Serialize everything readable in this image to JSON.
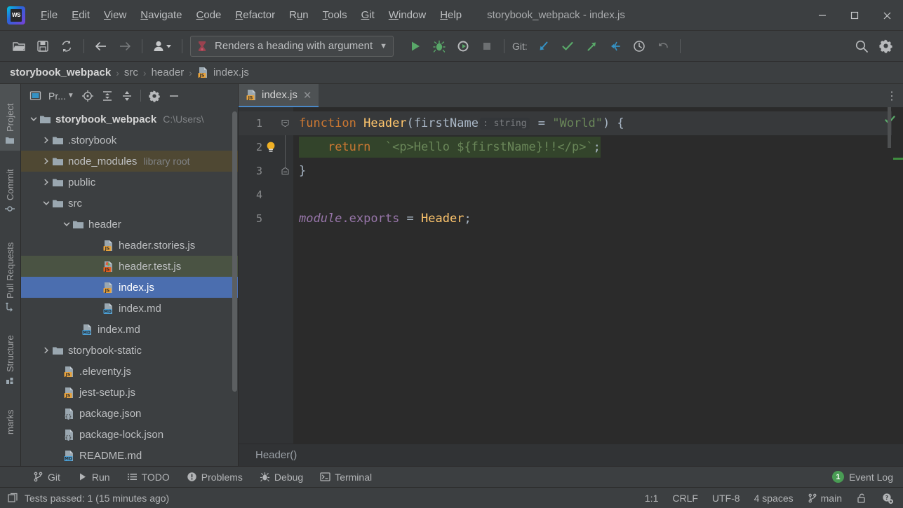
{
  "window": {
    "title": "storybook_webpack - index.js",
    "logo_text": "WS",
    "minimize_label": "—",
    "maximize_label": "□",
    "close_label": "✕"
  },
  "menubar": {
    "items": [
      {
        "label": "File",
        "mnemonic": "F"
      },
      {
        "label": "Edit",
        "mnemonic": "E"
      },
      {
        "label": "View",
        "mnemonic": "V"
      },
      {
        "label": "Navigate",
        "mnemonic": "N"
      },
      {
        "label": "Code",
        "mnemonic": "C"
      },
      {
        "label": "Refactor",
        "mnemonic": "R"
      },
      {
        "label": "Run",
        "mnemonic": "u"
      },
      {
        "label": "Tools",
        "mnemonic": "T"
      },
      {
        "label": "Git",
        "mnemonic": "G"
      },
      {
        "label": "Window",
        "mnemonic": "W"
      },
      {
        "label": "Help",
        "mnemonic": "H"
      }
    ]
  },
  "toolbar": {
    "open_tooltip": "Open",
    "save_tooltip": "Save All",
    "sync_tooltip": "Synchronize",
    "back_tooltip": "Back",
    "forward_tooltip": "Forward",
    "profile_tooltip": "User",
    "run_config": "Renders a heading with argument",
    "run_config_dropdown": "▼",
    "run_tooltip": "Run",
    "debug_tooltip": "Debug",
    "coverage_tooltip": "Run with Coverage",
    "stop_tooltip": "Stop",
    "git_label": "Git:",
    "git_update_tooltip": "Update Project",
    "git_commit_tooltip": "Commit",
    "git_push_tooltip": "Push",
    "git_rebase_tooltip": "Rebase",
    "git_history_tooltip": "History",
    "git_rollback_tooltip": "Rollback",
    "search_tooltip": "Search Everywhere",
    "settings_tooltip": "Settings"
  },
  "breadcrumb": {
    "items": [
      "storybook_webpack",
      "src",
      "header",
      "index.js"
    ],
    "separator": "›",
    "file_icon": "js-file-icon"
  },
  "stripe": {
    "items": [
      {
        "label": "Project",
        "icon": "folder-icon",
        "active": true
      },
      {
        "label": "Commit",
        "icon": "commit-icon",
        "active": false
      },
      {
        "label": "Pull Requests",
        "icon": "pull-request-icon",
        "active": false
      },
      {
        "label": "Structure",
        "icon": "structure-icon",
        "active": false
      },
      {
        "label": "marks",
        "icon": "bookmarks-icon",
        "active": false
      }
    ]
  },
  "project_panel": {
    "title": "Pr...",
    "dropdown_caret": "▼",
    "locate_tooltip": "Select Opened File",
    "expand_tooltip": "Expand All",
    "collapse_tooltip": "Collapse All",
    "settings_tooltip": "Options",
    "hide_tooltip": "Hide",
    "tree": [
      {
        "label": "storybook_webpack",
        "sub": "C:\\Users\\",
        "indent": 0,
        "arrow": "down",
        "icon": "folder-icon",
        "bold": true,
        "state": "none"
      },
      {
        "label": ".storybook",
        "sub": "",
        "indent": 1,
        "arrow": "right",
        "icon": "folder-icon",
        "bold": false,
        "state": "none"
      },
      {
        "label": "node_modules",
        "sub": "library root",
        "indent": 1,
        "arrow": "right",
        "icon": "folder-icon",
        "bold": false,
        "state": "libroot"
      },
      {
        "label": "public",
        "sub": "",
        "indent": 1,
        "arrow": "right",
        "icon": "folder-icon",
        "bold": false,
        "state": "none"
      },
      {
        "label": "src",
        "sub": "",
        "indent": 1,
        "arrow": "down",
        "icon": "folder-icon",
        "bold": false,
        "state": "none"
      },
      {
        "label": "header",
        "sub": "",
        "indent": 2,
        "arrow": "down",
        "icon": "folder-icon",
        "bold": false,
        "state": "none"
      },
      {
        "label": "header.stories.js",
        "sub": "",
        "indent": 3,
        "arrow": "none",
        "icon": "js-file-icon",
        "bold": false,
        "state": "none"
      },
      {
        "label": "header.test.js",
        "sub": "",
        "indent": 3,
        "arrow": "none",
        "icon": "js-test-file-icon",
        "bold": false,
        "state": "greenhl"
      },
      {
        "label": "index.js",
        "sub": "",
        "indent": 3,
        "arrow": "none",
        "icon": "js-file-icon",
        "bold": false,
        "state": "selected"
      },
      {
        "label": "index.md",
        "sub": "",
        "indent": 3,
        "arrow": "none",
        "icon": "md-file-icon",
        "bold": false,
        "state": "none"
      },
      {
        "label": "index.md",
        "sub": "",
        "indent": 2,
        "arrow": "none",
        "icon": "md-file-icon",
        "bold": false,
        "state": "none"
      },
      {
        "label": "storybook-static",
        "sub": "",
        "indent": 1,
        "arrow": "right",
        "icon": "folder-icon",
        "bold": false,
        "state": "none"
      },
      {
        "label": ".eleventy.js",
        "sub": "",
        "indent": 1,
        "arrow": "none",
        "icon": "js-file-icon",
        "bold": false,
        "state": "none"
      },
      {
        "label": "jest-setup.js",
        "sub": "",
        "indent": 1,
        "arrow": "none",
        "icon": "js-file-icon",
        "bold": false,
        "state": "none"
      },
      {
        "label": "package.json",
        "sub": "",
        "indent": 1,
        "arrow": "none",
        "icon": "json-file-icon",
        "bold": false,
        "state": "none"
      },
      {
        "label": "package-lock.json",
        "sub": "",
        "indent": 1,
        "arrow": "none",
        "icon": "json-file-icon",
        "bold": false,
        "state": "none"
      },
      {
        "label": "README.md",
        "sub": "",
        "indent": 1,
        "arrow": "none",
        "icon": "md-file-icon",
        "bold": false,
        "state": "none"
      }
    ]
  },
  "editor": {
    "tab": {
      "label": "index.js",
      "icon": "js-file-icon",
      "close": "✕"
    },
    "more_menu": "⋮",
    "lines": [
      {
        "number": "1",
        "fold": "open",
        "current": true,
        "bulb": false
      },
      {
        "number": "2",
        "fold": "none",
        "current": false,
        "bulb": true
      },
      {
        "number": "3",
        "fold": "close",
        "current": false,
        "bulb": false
      },
      {
        "number": "4",
        "fold": "none",
        "current": false,
        "bulb": false
      },
      {
        "number": "5",
        "fold": "none",
        "current": false,
        "bulb": false
      }
    ],
    "code": {
      "l1_kw": "function",
      "l1_fn": "Header",
      "l1_paren_open": "(",
      "l1_param": "firstName",
      "l1_inlay": ": string",
      "l1_eq": " = ",
      "l1_default": "\"World\"",
      "l1_tail": ") {",
      "l2_kw": "return",
      "l2_tpl": "`<p>Hello ${firstName}!!</p>`",
      "l2_semi": ";",
      "l3": "}",
      "l5_mod": "module",
      "l5_prop": ".exports",
      "l5_eq": " = ",
      "l5_ref": "Header",
      "l5_semi": ";"
    },
    "bottom_breadcrumb": "Header()",
    "inspection_status": "ok"
  },
  "tool_windows": {
    "items": [
      {
        "label": "Git",
        "icon": "git-branch-icon"
      },
      {
        "label": "Run",
        "icon": "run-icon"
      },
      {
        "label": "TODO",
        "icon": "todo-list-icon"
      },
      {
        "label": "Problems",
        "icon": "problems-icon"
      },
      {
        "label": "Debug",
        "icon": "debug-bug-icon"
      },
      {
        "label": "Terminal",
        "icon": "terminal-icon"
      }
    ],
    "event_log": {
      "label": "Event Log",
      "count": "1"
    }
  },
  "status_bar": {
    "message": "Tests passed: 1 (15 minutes ago)",
    "message_icon": "console-icon",
    "caret_position": "1:1",
    "line_separator": "CRLF",
    "encoding": "UTF-8",
    "indent": "4 spaces",
    "branch": "main",
    "branch_icon": "git-branch-icon",
    "lock_icon": "unlocked-icon",
    "inspection_icon": "inspection-settings-icon"
  },
  "colors": {
    "accent_blue": "#4b6eaf",
    "green": "#499c54",
    "keyword_orange": "#cc7832",
    "function_yellow": "#ffc66d",
    "string_green": "#6a8759",
    "purple": "#9876aa",
    "panel_bg": "#3c3f41",
    "editor_bg": "#2b2b2b"
  }
}
